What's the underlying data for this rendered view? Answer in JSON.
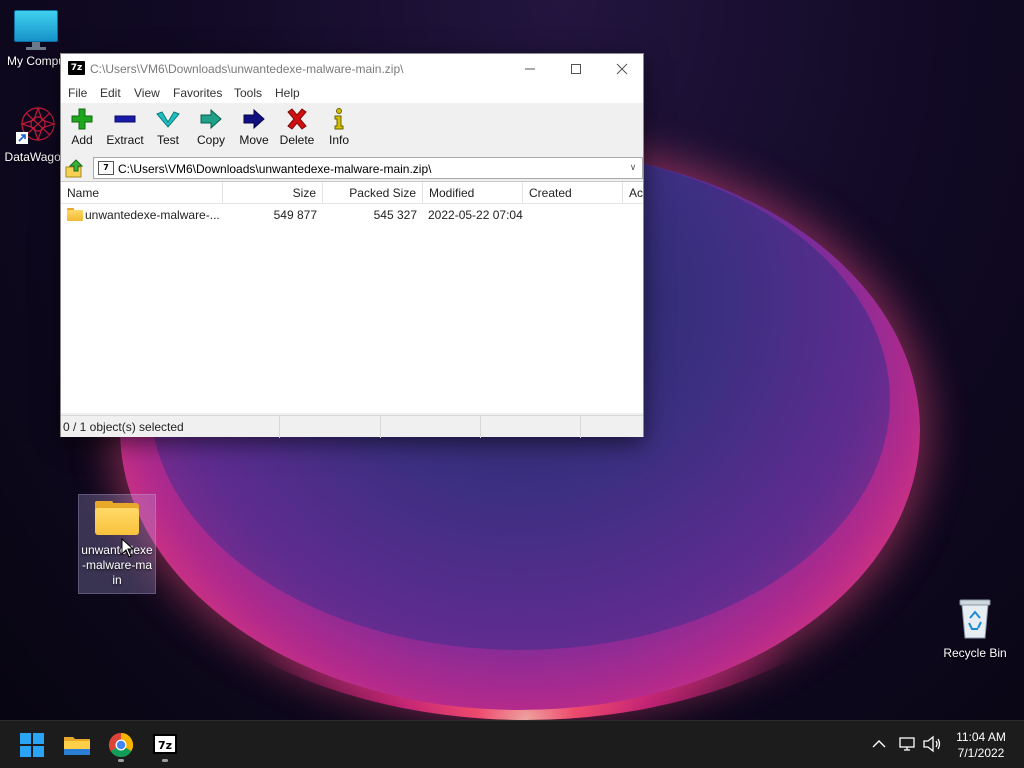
{
  "desktop": {
    "icons": [
      {
        "label": "My Compu"
      },
      {
        "label": "DataWagon"
      },
      {
        "label": "unwantedexe-malware-main"
      },
      {
        "label": "Recycle Bin"
      }
    ]
  },
  "window": {
    "app_icon_text": "7z",
    "title": "C:\\Users\\VM6\\Downloads\\unwantedexe-malware-main.zip\\",
    "menu": [
      "File",
      "Edit",
      "View",
      "Favorites",
      "Tools",
      "Help"
    ],
    "toolbar": [
      {
        "label": "Add",
        "icon": "plus-icon",
        "color": "#1fa61f"
      },
      {
        "label": "Extract",
        "icon": "minus-icon",
        "color": "#1a1aa8"
      },
      {
        "label": "Test",
        "icon": "check-icon",
        "color": "#1fbfbf"
      },
      {
        "label": "Copy",
        "icon": "copy-arrow-icon",
        "color": "#1fa088"
      },
      {
        "label": "Move",
        "icon": "move-arrow-icon",
        "color": "#101080"
      },
      {
        "label": "Delete",
        "icon": "x-icon",
        "color": "#d01010"
      },
      {
        "label": "Info",
        "icon": "info-icon",
        "color": "#d4c000"
      }
    ],
    "address": {
      "path": "C:\\Users\\VM6\\Downloads\\unwantedexe-malware-main.zip\\"
    },
    "columns": [
      "Name",
      "Size",
      "Packed Size",
      "Modified",
      "Created",
      "Ac"
    ],
    "rows": [
      {
        "name": "unwantedexe-malware-...",
        "size": "549 877",
        "packed": "545 327",
        "modified": "2022-05-22 07:04",
        "created": "",
        "accessed": ""
      }
    ],
    "status": {
      "selected": "0 / 1 object(s) selected"
    }
  },
  "taskbar": {
    "apps": [
      {
        "name": "Start",
        "icon": "windows-icon"
      },
      {
        "name": "File Explorer",
        "icon": "folder-icon"
      },
      {
        "name": "Google Chrome",
        "icon": "chrome-icon"
      },
      {
        "name": "7-Zip",
        "icon": "7zip-icon",
        "text": "7z"
      }
    ],
    "clock": {
      "time": "11:04 AM",
      "date": "7/1/2022"
    }
  }
}
